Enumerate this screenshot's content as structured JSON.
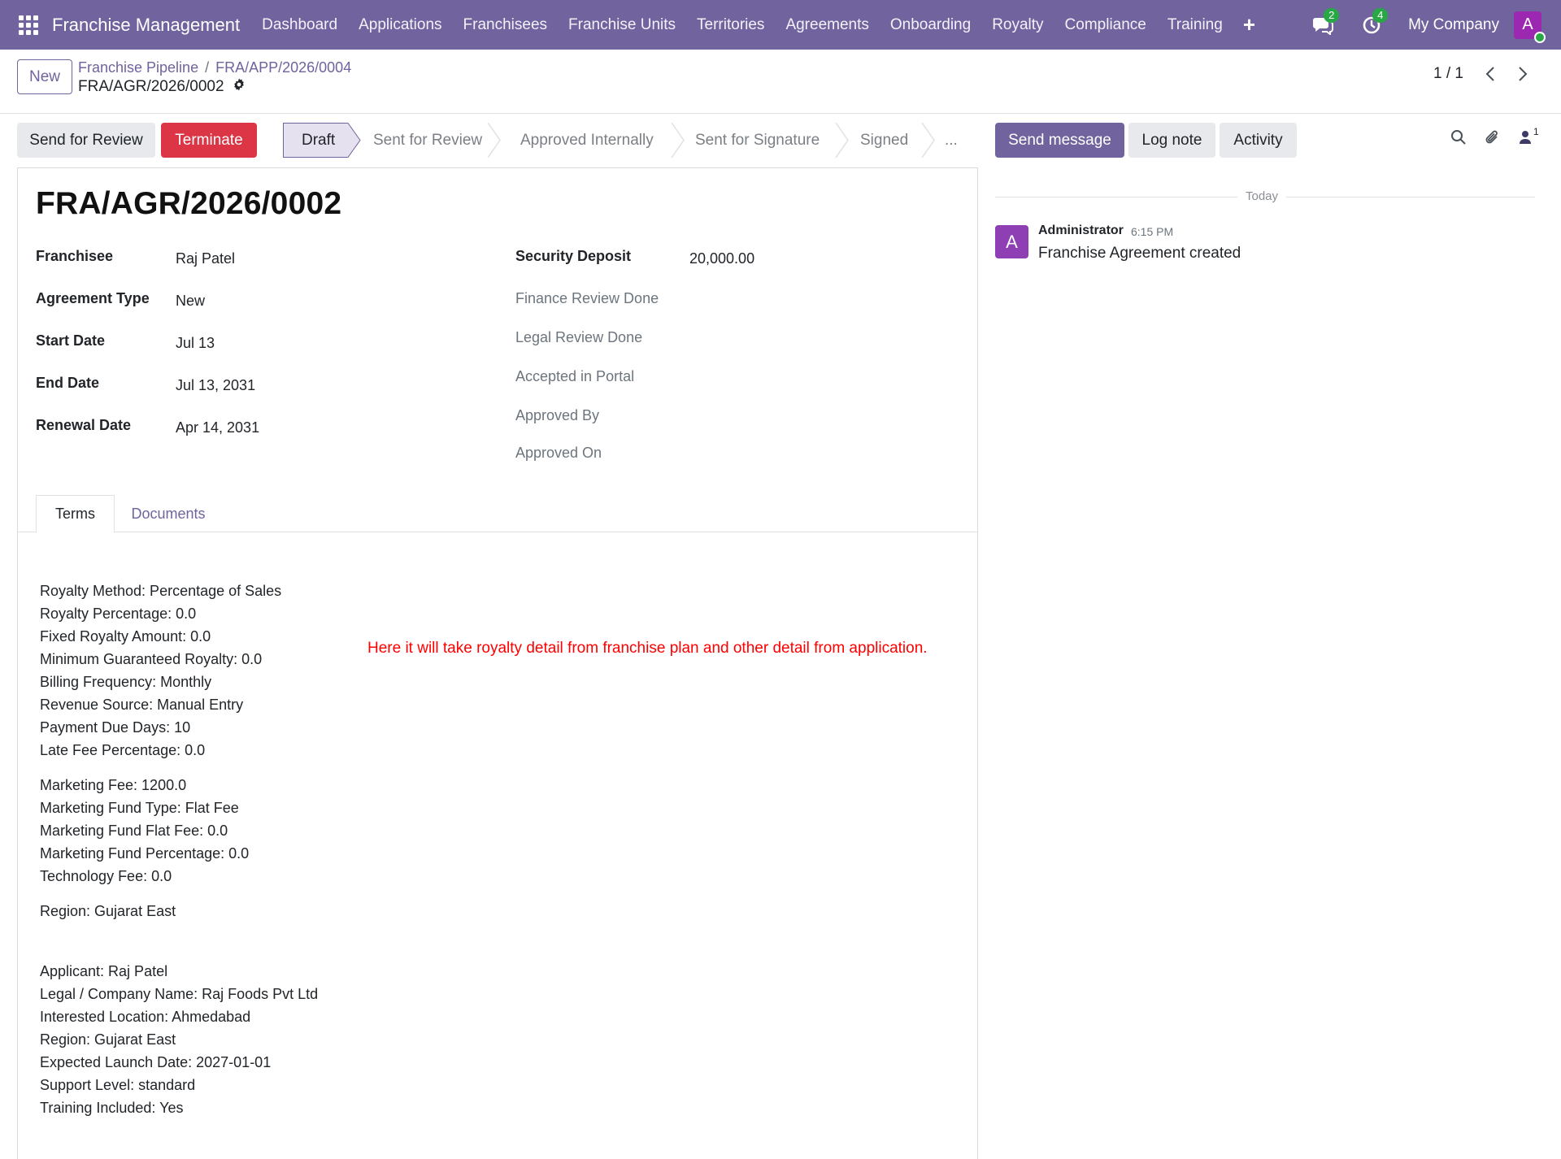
{
  "navbar": {
    "brand": "Franchise Management",
    "menu": [
      "Dashboard",
      "Applications",
      "Franchisees",
      "Franchise Units",
      "Territories",
      "Agreements",
      "Onboarding",
      "Royalty",
      "Compliance",
      "Training"
    ],
    "messages_count": "2",
    "activities_count": "4",
    "company": "My Company",
    "user_initial": "A"
  },
  "control": {
    "new_label": "New",
    "breadcrumb": [
      "Franchise Pipeline",
      "FRA/APP/2026/0004"
    ],
    "breadcrumb_sep": "/",
    "record_name": "FRA/AGR/2026/0002",
    "pager": "1 / 1"
  },
  "actions": {
    "send_review": "Send for Review",
    "terminate": "Terminate"
  },
  "stages": [
    "Draft",
    "Sent for Review",
    "Approved Internally",
    "Sent for Signature",
    "Signed",
    "..."
  ],
  "active_stage": "Draft",
  "form": {
    "title": "FRA/AGR/2026/0002",
    "left_fields": [
      {
        "label": "Franchisee",
        "value": "Raj Patel"
      },
      {
        "label": "Agreement Type",
        "value": "New"
      },
      {
        "label": "Start Date",
        "value": "Jul 13"
      },
      {
        "label": "End Date",
        "value": "Jul 13, 2031"
      },
      {
        "label": "Renewal Date",
        "value": "Apr 14, 2031"
      }
    ],
    "security_deposit_label": "Security Deposit",
    "security_deposit_value": "20,000.00",
    "right_labels": [
      "Finance Review Done",
      "Legal Review Done",
      "Accepted in Portal",
      "Approved By",
      "Approved On"
    ],
    "tabs": [
      "Terms",
      "Documents"
    ],
    "terms_blocks": [
      [
        "Royalty Method: Percentage of Sales",
        "Royalty Percentage: 0.0",
        "Fixed Royalty Amount: 0.0",
        "Minimum Guaranteed Royalty: 0.0",
        "Billing Frequency: Monthly",
        "Revenue Source: Manual Entry",
        "Payment Due Days: 10",
        "Late Fee Percentage: 0.0"
      ],
      [
        "Marketing Fee: 1200.0",
        "Marketing Fund Type: Flat Fee",
        "Marketing Fund Flat Fee: 0.0",
        "Marketing Fund Percentage: 0.0",
        "Technology Fee: 0.0"
      ],
      [
        "Region: Gujarat East"
      ],
      [
        "Applicant: Raj Patel",
        "Legal / Company Name: Raj Foods Pvt Ltd",
        "Interested Location: Ahmedabad",
        "Region: Gujarat East",
        "Expected Launch Date: 2027-01-01",
        "Support Level: standard",
        "Training Included: Yes"
      ]
    ],
    "note": "Here it will take royalty detail from franchise plan and other detail from application."
  },
  "chatter": {
    "send_message": "Send message",
    "log_note": "Log note",
    "activity": "Activity",
    "followers": "1",
    "date_separator": "Today",
    "message": {
      "author": "Administrator",
      "time": "6:15 PM",
      "body": "Franchise Agreement created",
      "initial": "A"
    }
  }
}
